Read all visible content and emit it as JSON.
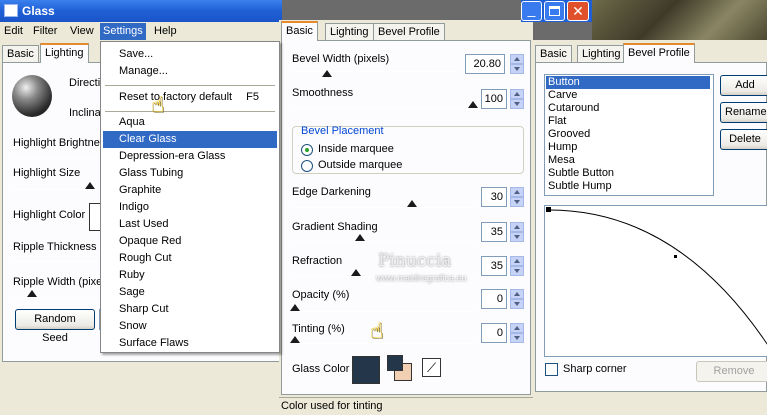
{
  "window": {
    "title": "Glass"
  },
  "menubar": {
    "items": [
      "Edit",
      "Filter",
      "View",
      "Settings",
      "Help"
    ]
  },
  "left_tabs": [
    "Basic",
    "Lighting"
  ],
  "left_panel": {
    "direction_label": "Directi",
    "inclination_label": "Inclina",
    "highlight_brightness": "Highlight Brightnes",
    "highlight_size": "Highlight Size",
    "highlight_color": "Highlight Color",
    "ripple_thickness": "Ripple Thickness",
    "ripple_width": "Ripple Width (pixe",
    "random_seed": "Random Seed"
  },
  "dropdown": {
    "top": [
      {
        "label": "Save..."
      },
      {
        "label": "Manage..."
      }
    ],
    "reset": {
      "label": "Reset to factory default",
      "shortcut": "F5"
    },
    "presets": [
      "Aqua",
      "Clear Glass",
      "Depression-era Glass",
      "Glass Tubing",
      "Graphite",
      "Indigo",
      "Last Used",
      "Opaque Red",
      "Rough Cut",
      "Ruby",
      "Sage",
      "Sharp Cut",
      "Snow",
      "Surface Flaws"
    ],
    "highlighted": "Clear Glass"
  },
  "mid_tabs": [
    "Basic",
    "Lighting",
    "Bevel Profile"
  ],
  "basic": {
    "bevel_width": {
      "label": "Bevel Width (pixels)",
      "value": "20.80"
    },
    "smoothness": {
      "label": "Smoothness",
      "value": "100"
    },
    "bevel_placement": {
      "legend": "Bevel Placement",
      "options": [
        "Inside marquee",
        "Outside marquee"
      ],
      "selected": "Inside marquee"
    },
    "edge_darkening": {
      "label": "Edge Darkening",
      "value": "30"
    },
    "gradient_shading": {
      "label": "Gradient Shading",
      "value": "35"
    },
    "refraction": {
      "label": "Refraction",
      "value": "35"
    },
    "opacity": {
      "label": "Opacity (%)",
      "value": "0"
    },
    "tinting": {
      "label": "Tinting (%)",
      "value": "0"
    },
    "glass_color": {
      "label": "Glass Color",
      "color": "#24364a"
    }
  },
  "status": {
    "text": "Color used for tinting"
  },
  "watermark": {
    "name": "Pinuccia",
    "url": "www.maidiregrafica.eu"
  },
  "right_tabs": [
    "Basic",
    "Lighting",
    "Bevel Profile"
  ],
  "bevel_profile": {
    "items": [
      "Button",
      "Carve",
      "Cutaround",
      "Flat",
      "Grooved",
      "Hump",
      "Mesa",
      "Subtle Button",
      "Subtle Hump"
    ],
    "selected": "Button",
    "buttons": [
      "Add",
      "Rename",
      "Delete"
    ],
    "sharp_corner": "Sharp corner",
    "remove": "Remove"
  },
  "colors": {
    "accent": "#316ac5",
    "title_bar": "#1f5fd6",
    "tab_highlight": "#e68b2c",
    "hand": "#f2c200"
  }
}
